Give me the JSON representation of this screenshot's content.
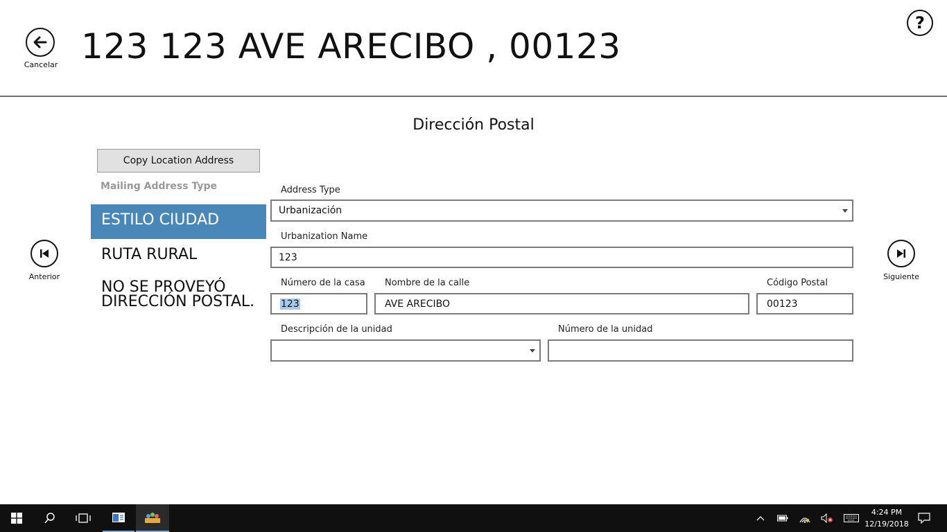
{
  "header": {
    "title": "123 123 AVE ARECIBO , 00123",
    "back_label": "Cancelar",
    "help_glyph": "?"
  },
  "section_title": "Dirección Postal",
  "nav": {
    "prev_label": "Anterior",
    "next_label": "Siguiente"
  },
  "left_panel": {
    "copy_button": "Copy Location Address",
    "mailing_type_label": "Mailing Address Type",
    "types": [
      {
        "label": "ESTILO CIUDAD",
        "selected": true
      },
      {
        "label": "RUTA RURAL",
        "selected": false
      },
      {
        "label": "NO SE PROVEYÓ DIRECCIÓN POSTAL.",
        "selected": false
      }
    ]
  },
  "form": {
    "address_type_label": "Address Type",
    "address_type_value": "Urbanización",
    "urbanization_label": "Urbanization Name",
    "urbanization_value": "123",
    "house_number_label": "Número de la casa",
    "house_number_value": "123",
    "street_name_label": "Nombre de la calle",
    "street_name_value": "AVE ARECIBO",
    "postal_code_label": "Código Postal",
    "postal_code_value": "00123",
    "unit_desc_label": "Descripción de la unidad",
    "unit_desc_value": "",
    "unit_number_label": "Número de la unidad",
    "unit_number_value": ""
  },
  "taskbar": {
    "time": "4:24 PM",
    "date": "12/19/2018",
    "icons": [
      "windows-start-icon",
      "search-icon",
      "task-view-icon",
      "app-window-icon",
      "people-app-icon",
      "chevron-up-icon",
      "battery-icon",
      "wifi-icon",
      "volume-muted-icon",
      "keyboard-icon",
      "notification-icon"
    ]
  },
  "colors": {
    "selected_item": "#4a87b9",
    "taskbar": "#101010",
    "divider": "#6e6e6e"
  }
}
